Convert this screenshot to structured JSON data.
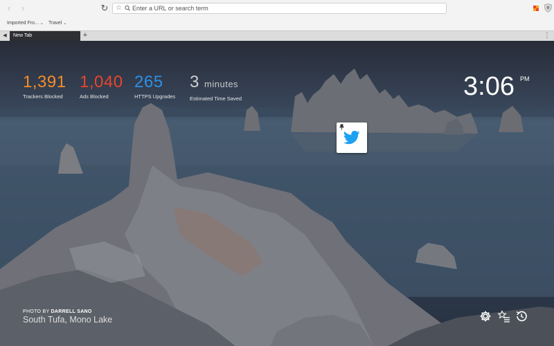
{
  "browser": {
    "url_placeholder": "Enter a URL or search term",
    "bookmarks": [
      {
        "label": "Imported Fro..."
      },
      {
        "label": "Travel"
      }
    ],
    "tabs": [
      {
        "label": "New Tab",
        "active": true
      }
    ],
    "colors": {
      "indicator_active": "#e13b2b",
      "indicator_inactive": "#ffffff"
    }
  },
  "stats": [
    {
      "value": "1,391",
      "label": "Trackers Blocked",
      "color": "#f58c2a"
    },
    {
      "value": "1,040",
      "label": "Ads Blocked",
      "color": "#e8452e"
    },
    {
      "value": "265",
      "label": "HTTPS Upgrades",
      "color": "#2e8fe5"
    },
    {
      "value": "3",
      "unit": "minutes",
      "label": "Estimated Time Saved",
      "color": "#cfcfcf"
    }
  ],
  "clock": {
    "time": "3:06",
    "period": "PM"
  },
  "top_sites": [
    {
      "icon": "twitter-bird-icon",
      "color": "#1da1f2"
    }
  ],
  "photo_credit": {
    "prefix": "PHOTO BY",
    "photographer": "DARRELL SANO",
    "location": "South Tufa, Mono Lake"
  },
  "bottom_icons": [
    "gear-icon",
    "bookmarks-icon",
    "history-icon"
  ]
}
